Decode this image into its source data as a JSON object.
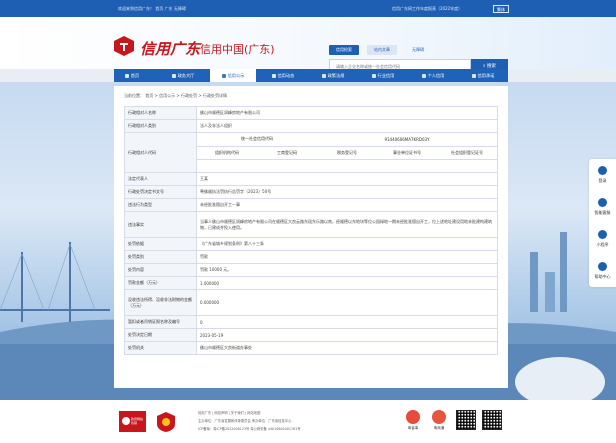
{
  "topbar": {
    "welcome": "欢迎来到信用广东！  首页  广东  无障碍",
    "report": "信用广东网工作年度报表（2022年度）",
    "lang_button": "繁体"
  },
  "header": {
    "site_name": "信用广东",
    "site_sub": "信用中国(广东)",
    "search_tabs": [
      "信用检索",
      "站内文章",
      "无障碍"
    ],
    "search_placeholder": "请输入企业名称或统一社会信用代码",
    "search_button": "搜索"
  },
  "nav": {
    "items": [
      {
        "label": "首页",
        "icon": "home-icon"
      },
      {
        "label": "政务大厅",
        "icon": "hall-icon"
      },
      {
        "label": "信用公示",
        "icon": "publicity-icon"
      },
      {
        "label": "信用动态",
        "icon": "news-icon"
      },
      {
        "label": "政策法规",
        "icon": "policy-icon"
      },
      {
        "label": "行业信用",
        "icon": "industry-icon"
      },
      {
        "label": "个人信用",
        "icon": "person-icon"
      },
      {
        "label": "信用承诺",
        "icon": "promise-icon"
      }
    ],
    "active_index": 2
  },
  "breadcrumb": "当前位置：  首页  >  信用公示  >  行政处罚  >  行政处罚详情",
  "detail": {
    "rows_top": [
      {
        "label": "行政相对人名称",
        "value": "佛山市顺德区润峰房地产有限公司"
      },
      {
        "label": "行政相对人类别",
        "value": "法人及非法人组织"
      }
    ],
    "code_label": "行政相对人代码",
    "code_headers_top": "统一社会信用代码",
    "code_value_top": "91440606MA7KRD03Y",
    "code_headers": [
      "组织机构代码",
      "工商登记码",
      "税务登记号",
      "事业单位证书号",
      "社会组织登记证号"
    ],
    "code_values": [
      "",
      "",
      "",
      "",
      ""
    ],
    "rows_bottom": [
      {
        "label": "法定代表人",
        "value": "王某"
      },
      {
        "label": "行政处罚决定书文号",
        "value": "粤佛顺执法罚执行告罚字〔2023〕50号"
      },
      {
        "label": "违法行为类型",
        "value": "未经批准擅自开工一事"
      },
      {
        "label": "违法事实",
        "value": "当事人佛山市顺德区润峰房地产有限公司在顺德区大良云路东段东乐路以南，经顺德以东地块等位公园绿地一期未经批准擅自开工，位上述地址建设用地未批建构建筑物，已建成并投入使用。"
      },
      {
        "label": "处罚依据",
        "value": "《广东省城乡规划条例》第八十三条"
      },
      {
        "label": "处罚类别",
        "value": "罚款"
      },
      {
        "label": "处罚内容",
        "value": "罚款 10000 元。"
      },
      {
        "label": "罚款金额（万元）",
        "value": "1.000000"
      },
      {
        "label": "没收违法所得、没收非法财物的金额（万元）",
        "value": "0.000000"
      },
      {
        "label": "暂扣或者吊销证照名称及编号",
        "value": "0"
      },
      {
        "label": "处罚决定日期",
        "value": "2023-05-19"
      },
      {
        "label": "处罚机关",
        "value": "佛山市顺德区大良街道办事处"
      }
    ]
  },
  "sidebar": {
    "items": [
      {
        "label": "登录",
        "icon": "user-icon"
      },
      {
        "label": "智能客服",
        "icon": "chat-icon"
      },
      {
        "label": "小程序",
        "icon": "miniapp-icon"
      },
      {
        "label": "帮助中心",
        "icon": "help-icon"
      }
    ]
  },
  "footer": {
    "line1": "信用广东  |  网站声明  |  关于我们  |  网站地图",
    "line2": "主办单位：广东省发展和改革委员会    承办单位：广东省信息中心",
    "line3": "ICP备案：粤ICP备2022008123号    粤公网安备 44010602001761号",
    "badge1_text": "政府网站 找错",
    "apps": [
      "粤省事",
      "粤商通"
    ],
    "colors": {
      "primary": "#1e5fb3",
      "brand_red": "#c8161d"
    }
  }
}
